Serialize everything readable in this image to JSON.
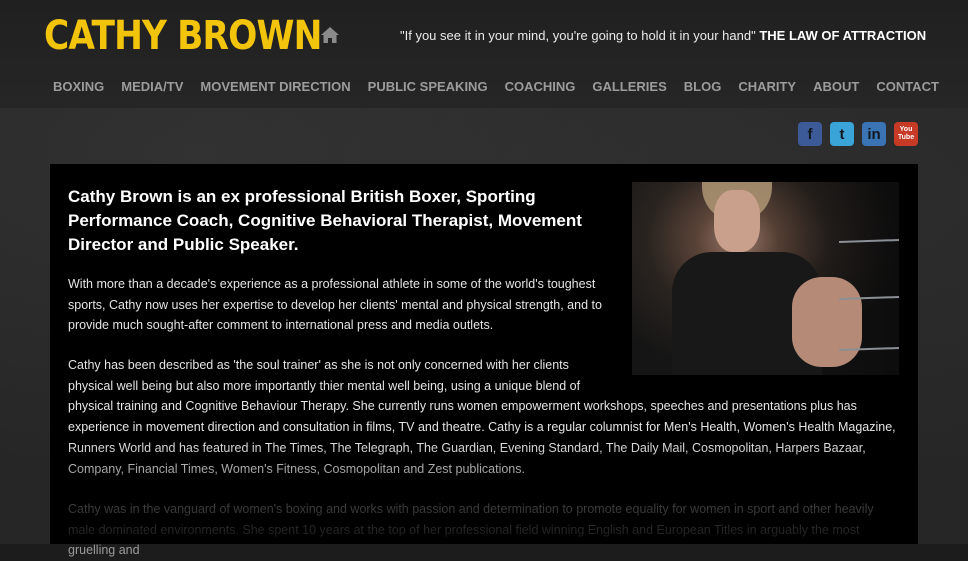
{
  "header": {
    "logo": "CATHY BROWN",
    "quote": "\"If you see it in your mind, you're going to hold it in your hand\"",
    "quote_attribution": "THE LAW OF ATTRACTION"
  },
  "nav": {
    "items": [
      "BOXING",
      "MEDIA/TV",
      "MOVEMENT DIRECTION",
      "PUBLIC SPEAKING",
      "COACHING",
      "GALLERIES",
      "BLOG",
      "CHARITY",
      "ABOUT",
      "CONTACT"
    ]
  },
  "social": {
    "icons": [
      "facebook-icon",
      "twitter-icon",
      "linkedin-icon",
      "youtube-icon"
    ],
    "facebook_glyph": "f",
    "twitter_glyph": "t",
    "linkedin_glyph": "in",
    "youtube_glyph_top": "You",
    "youtube_glyph_bottom": "Tube"
  },
  "main": {
    "headline": "Cathy Brown is an ex professional British Boxer, Sporting Performance Coach, Cognitive Behavioral Therapist, Movement Director and Public Speaker.",
    "paragraph_1": "With more than a decade's experience as a professional athlete in some of the world's toughest sports, Cathy now uses her expertise to develop her clients' mental and physical strength, and to provide much sought-after comment to international press and media outlets.",
    "paragraph_2_wrap": "Cathy has been described as 'the soul trainer' as she is not only concerned with her clients physical well being but also more importantly thier mental well being, using a unique blend of",
    "paragraph_2_rest": "physical training and Cognitive Behaviour Therapy. She currently runs women empowerment workshops, speeches and presentations plus has experience in movement direction and consultation in films, TV and theatre. Cathy is a regular columnist for Men's Health, Women's Health Magazine, Runners World and has featured in The Times, The Telegraph, The Guardian, Evening Standard, The Daily Mail, Cosmopolitan, Harpers Bazaar, Company, Financial Times, Women's Fitness, Cosmopolitan and Zest publications.",
    "paragraph_3": "Cathy was in the vanguard of women's boxing and works with passion and determination to promote equality for women in sport and other heavily male dominated environments. She spent 10 years at the top of her professional field winning English and European Titles in arguably the most gruelling and"
  },
  "colors": {
    "logo": "#f2c40c",
    "nav_text": "#9c9c9c",
    "facebook": "#3d5a98",
    "twitter": "#3aa3d8",
    "linkedin": "#3b74b4",
    "youtube": "#c63a26"
  }
}
